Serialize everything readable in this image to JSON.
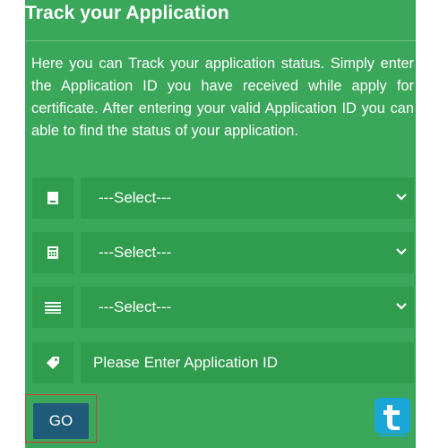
{
  "header": {
    "title": "Track your Application"
  },
  "description": "Here you can Track your application status. Simply enter the Application ID you have received while apply for certificate. After entering your valid Application ID you can able to find the status of your application.",
  "fields": [
    {
      "icon": "document-icon",
      "type": "select",
      "value": "---Select---"
    },
    {
      "icon": "calculator-icon",
      "type": "select",
      "value": "---Select---"
    },
    {
      "icon": "list-icon",
      "type": "select",
      "value": "---Select---"
    },
    {
      "icon": "tag-icon",
      "type": "input",
      "placeholder": "Please Enter Application ID"
    }
  ],
  "go_button": {
    "label": "GO"
  },
  "colors": {
    "panel": "#3aa75a",
    "field": "#2f9c4e",
    "button": "#1f5a78",
    "highlight": "#d9382c",
    "logo": "#1aa6d6"
  },
  "logo": {
    "icon": "t-logo-icon"
  }
}
